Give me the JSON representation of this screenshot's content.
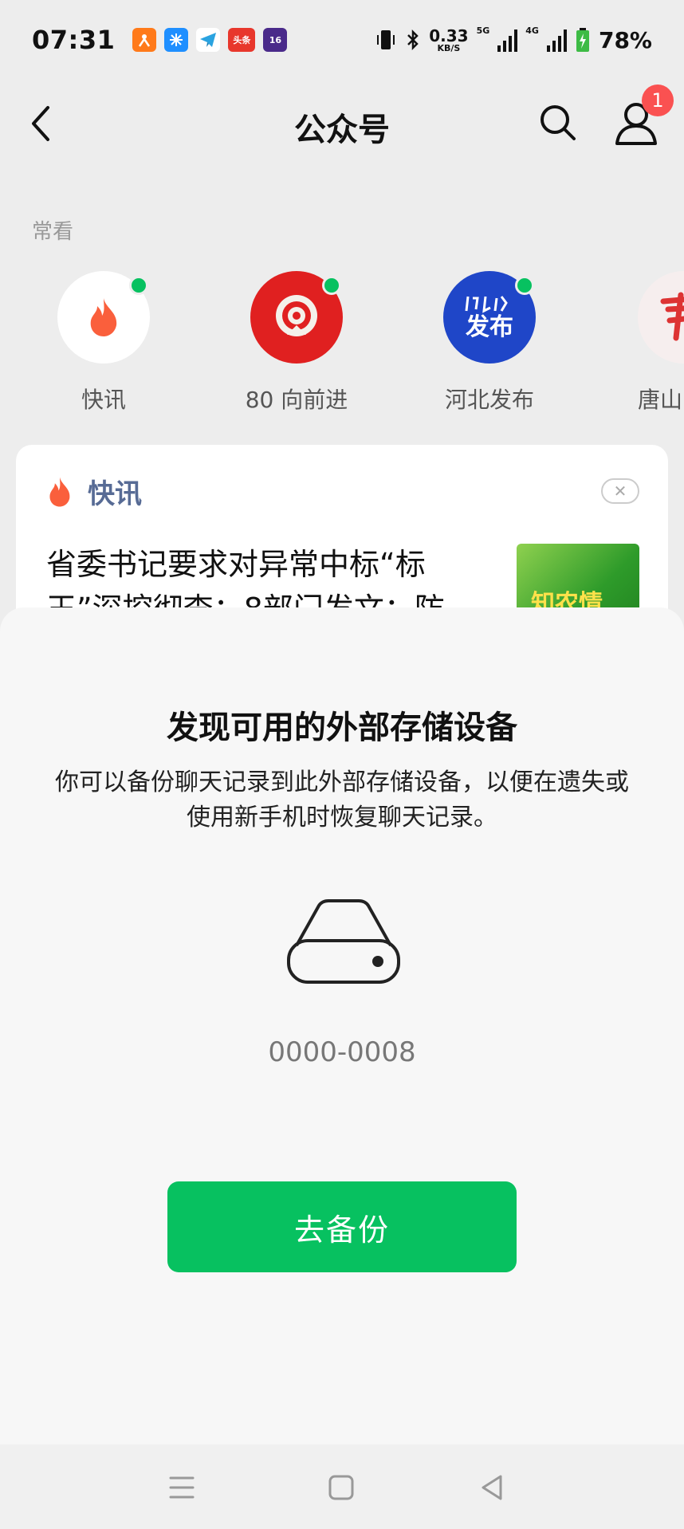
{
  "status_bar": {
    "time": "07:31",
    "notification_icons": [
      {
        "icon": "app-orange-icon",
        "color": "#ff7a1a"
      },
      {
        "icon": "app-blue-snow-icon",
        "color": "#1f8fff"
      },
      {
        "icon": "app-telegram-icon",
        "color": "#2aa3e0"
      },
      {
        "icon": "app-toutiao-icon",
        "color": "#e8372c",
        "text": "头条"
      },
      {
        "icon": "app-16-icon",
        "color": "#4a2a8a",
        "text": "16"
      }
    ],
    "net_speed_value": "0.33",
    "net_speed_unit": "KB/S",
    "signal_label_1": "5G",
    "signal_label_2": "4G",
    "battery": "78%"
  },
  "nav": {
    "title": "公众号",
    "badge_count": "1"
  },
  "frequent": {
    "label": "常看",
    "accounts": [
      {
        "name": "快讯"
      },
      {
        "name": "80 向前进"
      },
      {
        "name": "河北发布",
        "avatar_text": "发布"
      },
      {
        "name": "唐山"
      }
    ]
  },
  "card": {
    "title": "快讯",
    "headline": "省委书记要求对异常中标“标王”深挖彻查；8部门发文：防",
    "thumb_text": "知农情"
  },
  "sheet": {
    "title": "发现可用的外部存储设备",
    "description": "你可以备份聊天记录到此外部存储设备，以便在遗失或使用新手机时恢复聊天记录。",
    "device_id": "0000-0008",
    "button_label": "去备份"
  },
  "colors": {
    "accent_green": "#07c160",
    "badge_red": "#fa5151",
    "link_blue": "#576b95"
  }
}
